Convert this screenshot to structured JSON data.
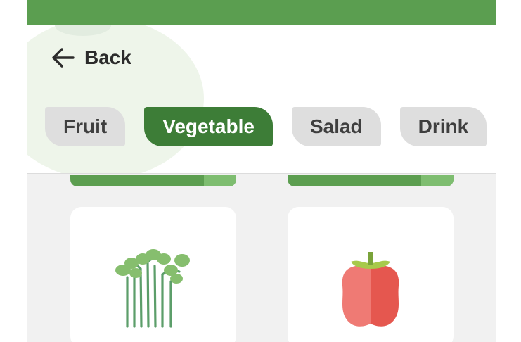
{
  "header": {
    "back_label": "Back"
  },
  "tabs": [
    {
      "label": "Fruit",
      "active": false
    },
    {
      "label": "Vegetable",
      "active": true
    },
    {
      "label": "Salad",
      "active": false
    },
    {
      "label": "Drink",
      "active": false
    }
  ],
  "items": [
    {
      "icon": "microgreens-icon"
    },
    {
      "icon": "bell-pepper-icon"
    }
  ],
  "colors": {
    "status_bar": "#5b9e50",
    "active_tab": "#3d7d37",
    "inactive_tab": "#dedede",
    "background": "#f1f1f1"
  }
}
